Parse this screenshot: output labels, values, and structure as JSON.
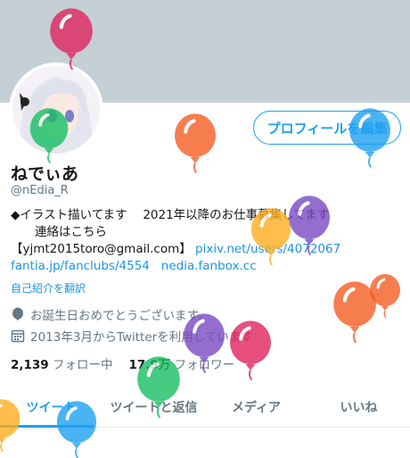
{
  "profile": {
    "name": "ねでぃあ",
    "handle": "@nEdia_R",
    "edit_profile": "プロフィールを編集",
    "bio_line1": "◆イラスト描いてます　  2021年以降のお仕事募集してます",
    "bio_line2": "　　連絡はこちら",
    "bio_email": "【yjmt2015toro@gmail.com】",
    "bio_link1": "pixiv.net/users/4072067",
    "bio_link2": "fantia.jp/fanclubs/4554",
    "bio_link3": "nedia.fanbox.cc",
    "translate": "自己紹介を翻訳",
    "birthday": "お誕生日おめでとうございます。",
    "joined": "2013年3月からTwitterを利用しています",
    "following_count": "2,139",
    "following_label": "フォロー中",
    "followers_count": "17.9万",
    "followers_label": "フォロワー"
  },
  "tabs": [
    "ツイート",
    "ツイートと返信",
    "メディア",
    "いいね"
  ],
  "colors": {
    "accent": "#1da1f2",
    "banner": "#c4cfd6",
    "balloons": [
      "#e0245e",
      "#17bf63",
      "#f45d22",
      "#1da1f2",
      "#ffad1f",
      "#794bc4"
    ]
  }
}
